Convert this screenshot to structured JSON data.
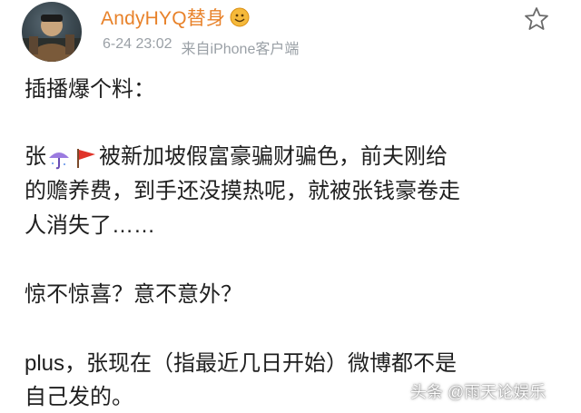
{
  "post": {
    "username": "AndyHYQ替身",
    "timestamp": "6-24 23:02",
    "source": "来自iPhone客户端",
    "lines": {
      "l1": "插播爆个料：",
      "l2_a": "张",
      "l2_b": "被新加坡假富豪骗财骗色，前夫刚给",
      "l3": "的赡养费，到手还没摸热呢，就被张钱豪卷走",
      "l4": "人消失了……",
      "l5": "惊不惊喜？意不意外？",
      "l6": "plus，张现在（指最近几日开始）微博都不是",
      "l7": "自己发的。"
    },
    "icons": {
      "avatar": "avatar-photo",
      "badge": "verified-gold-badge",
      "favorite": "star-icon",
      "inline_1": "umbrella-icon",
      "inline_2": "red-flag-icon"
    }
  },
  "watermark": "头条 @雨天论娱乐",
  "colors": {
    "username": "#e8822a",
    "meta": "#9aa0a6",
    "text": "#1f1f1f",
    "background": "#ffffff"
  }
}
